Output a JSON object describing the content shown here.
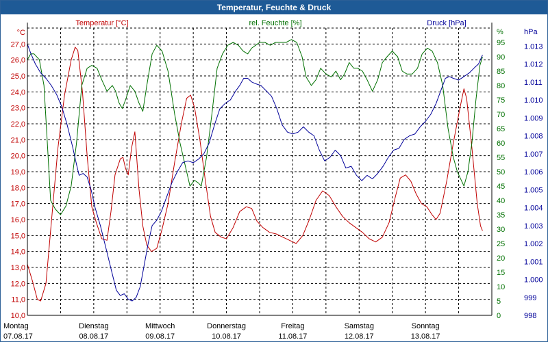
{
  "window": {
    "title": "Temperatur, Feuchte & Druck"
  },
  "colors": {
    "temperature": "#c00000",
    "humidity": "#007000",
    "pressure": "#000099",
    "grid": "#000000",
    "titlebar": "#1e5a96"
  },
  "chart_data": {
    "type": "line",
    "grid": true,
    "legend_placement": "top",
    "x_range": [
      0,
      7
    ],
    "x_ticks": [
      {
        "x": 0,
        "day": "Montag",
        "date": "07.08.17"
      },
      {
        "x": 1,
        "day": "Dienstag",
        "date": "08.08.17"
      },
      {
        "x": 2,
        "day": "Mittwoch",
        "date": "09.08.17"
      },
      {
        "x": 3,
        "day": "Donnerstag",
        "date": "10.08.17"
      },
      {
        "x": 4,
        "day": "Freitag",
        "date": "11.08.17"
      },
      {
        "x": 5,
        "day": "Samstag",
        "date": "12.08.17"
      },
      {
        "x": 6,
        "day": "Sonntag",
        "date": "13.08.17"
      }
    ],
    "axes": {
      "left": {
        "unit": "°C",
        "range": [
          10,
          28
        ],
        "ticks": [
          "10,0",
          "11,0",
          "12,0",
          "13,0",
          "14,0",
          "15,0",
          "16,0",
          "17,0",
          "18,0",
          "19,0",
          "20,0",
          "21,0",
          "22,0",
          "23,0",
          "24,0",
          "25,0",
          "26,0",
          "27,0"
        ]
      },
      "middle": {
        "unit": "%",
        "range": [
          0,
          100
        ],
        "ticks": [
          "0",
          "5",
          "10",
          "15",
          "20",
          "25",
          "30",
          "35",
          "40",
          "45",
          "50",
          "55",
          "60",
          "65",
          "70",
          "75",
          "80",
          "85",
          "90",
          "95"
        ]
      },
      "right": {
        "unit": "hPa",
        "range": [
          998,
          1014
        ],
        "ticks": [
          "998",
          "999",
          "1.000",
          "1.001",
          "1.002",
          "1.003",
          "1.004",
          "1.005",
          "1.006",
          "1.007",
          "1.008",
          "1.009",
          "1.010",
          "1.011",
          "1.012",
          "1.013"
        ]
      }
    },
    "series": [
      {
        "name": "Temperatur [°C]",
        "axis": "left",
        "color": "#c00000",
        "points": [
          [
            0,
            13.2
          ],
          [
            0.08,
            12.1
          ],
          [
            0.15,
            11.0
          ],
          [
            0.2,
            10.9
          ],
          [
            0.28,
            12.0
          ],
          [
            0.36,
            15.8
          ],
          [
            0.46,
            20.5
          ],
          [
            0.56,
            23.8
          ],
          [
            0.66,
            26.0
          ],
          [
            0.72,
            26.8
          ],
          [
            0.76,
            26.6
          ],
          [
            0.83,
            24.0
          ],
          [
            0.9,
            20.0
          ],
          [
            0.97,
            16.8
          ],
          [
            1.04,
            15.8
          ],
          [
            1.12,
            14.8
          ],
          [
            1.2,
            14.7
          ],
          [
            1.26,
            16.5
          ],
          [
            1.32,
            18.8
          ],
          [
            1.4,
            19.8
          ],
          [
            1.44,
            19.9
          ],
          [
            1.48,
            19.2
          ],
          [
            1.52,
            18.8
          ],
          [
            1.57,
            20.5
          ],
          [
            1.62,
            21.5
          ],
          [
            1.68,
            18.0
          ],
          [
            1.74,
            15.6
          ],
          [
            1.8,
            14.4
          ],
          [
            1.87,
            14.0
          ],
          [
            1.95,
            14.2
          ],
          [
            2.03,
            15.4
          ],
          [
            2.12,
            17.0
          ],
          [
            2.22,
            19.6
          ],
          [
            2.32,
            22.0
          ],
          [
            2.4,
            23.6
          ],
          [
            2.46,
            23.8
          ],
          [
            2.52,
            23.0
          ],
          [
            2.6,
            21.0
          ],
          [
            2.68,
            18.5
          ],
          [
            2.76,
            16.2
          ],
          [
            2.83,
            15.2
          ],
          [
            2.92,
            14.9
          ],
          [
            3.0,
            14.8
          ],
          [
            3.1,
            15.5
          ],
          [
            3.2,
            16.5
          ],
          [
            3.3,
            16.8
          ],
          [
            3.38,
            16.7
          ],
          [
            3.46,
            15.9
          ],
          [
            3.55,
            15.5
          ],
          [
            3.65,
            15.2
          ],
          [
            3.75,
            15.1
          ],
          [
            3.85,
            14.9
          ],
          [
            3.95,
            14.7
          ],
          [
            4.05,
            14.5
          ],
          [
            4.15,
            15.0
          ],
          [
            4.25,
            16.0
          ],
          [
            4.35,
            17.2
          ],
          [
            4.45,
            17.8
          ],
          [
            4.55,
            17.5
          ],
          [
            4.65,
            16.8
          ],
          [
            4.75,
            16.2
          ],
          [
            4.85,
            15.8
          ],
          [
            4.95,
            15.5
          ],
          [
            5.05,
            15.2
          ],
          [
            5.15,
            14.8
          ],
          [
            5.25,
            14.6
          ],
          [
            5.35,
            14.9
          ],
          [
            5.45,
            15.8
          ],
          [
            5.55,
            17.5
          ],
          [
            5.62,
            18.6
          ],
          [
            5.7,
            18.8
          ],
          [
            5.78,
            18.4
          ],
          [
            5.86,
            17.6
          ],
          [
            5.94,
            17.0
          ],
          [
            6.02,
            16.8
          ],
          [
            6.1,
            16.3
          ],
          [
            6.16,
            16.0
          ],
          [
            6.22,
            16.4
          ],
          [
            6.32,
            18.4
          ],
          [
            6.42,
            20.8
          ],
          [
            6.52,
            23.0
          ],
          [
            6.58,
            24.2
          ],
          [
            6.62,
            23.6
          ],
          [
            6.7,
            20.5
          ],
          [
            6.78,
            17.0
          ],
          [
            6.83,
            15.6
          ],
          [
            6.86,
            15.3
          ]
        ]
      },
      {
        "name": "rel. Feuchte [%]",
        "axis": "middle",
        "color": "#007000",
        "points": [
          [
            0,
            89
          ],
          [
            0.05,
            91
          ],
          [
            0.1,
            91
          ],
          [
            0.18,
            89
          ],
          [
            0.25,
            80
          ],
          [
            0.3,
            60
          ],
          [
            0.35,
            40
          ],
          [
            0.42,
            37
          ],
          [
            0.5,
            35
          ],
          [
            0.58,
            38
          ],
          [
            0.66,
            45
          ],
          [
            0.74,
            60
          ],
          [
            0.82,
            80
          ],
          [
            0.9,
            86
          ],
          [
            0.97,
            87
          ],
          [
            1.05,
            86
          ],
          [
            1.12,
            82
          ],
          [
            1.2,
            78
          ],
          [
            1.28,
            80
          ],
          [
            1.33,
            78
          ],
          [
            1.38,
            74
          ],
          [
            1.43,
            72
          ],
          [
            1.48,
            75
          ],
          [
            1.55,
            80
          ],
          [
            1.62,
            78
          ],
          [
            1.68,
            74
          ],
          [
            1.74,
            71
          ],
          [
            1.8,
            80
          ],
          [
            1.88,
            91
          ],
          [
            1.95,
            94
          ],
          [
            2.03,
            92
          ],
          [
            2.12,
            85
          ],
          [
            2.22,
            70
          ],
          [
            2.3,
            60
          ],
          [
            2.38,
            52
          ],
          [
            2.45,
            45
          ],
          [
            2.52,
            47
          ],
          [
            2.58,
            46
          ],
          [
            2.62,
            45
          ],
          [
            2.7,
            55
          ],
          [
            2.78,
            70
          ],
          [
            2.86,
            86
          ],
          [
            2.94,
            91
          ],
          [
            3.02,
            94
          ],
          [
            3.1,
            95
          ],
          [
            3.18,
            94
          ],
          [
            3.25,
            92
          ],
          [
            3.32,
            91
          ],
          [
            3.38,
            93
          ],
          [
            3.44,
            94
          ],
          [
            3.5,
            95
          ],
          [
            3.58,
            95
          ],
          [
            3.66,
            94
          ],
          [
            3.74,
            95
          ],
          [
            3.82,
            95
          ],
          [
            3.9,
            95
          ],
          [
            3.98,
            96
          ],
          [
            4.06,
            95
          ],
          [
            4.14,
            90
          ],
          [
            4.2,
            83
          ],
          [
            4.28,
            80
          ],
          [
            4.35,
            82
          ],
          [
            4.42,
            86
          ],
          [
            4.5,
            84
          ],
          [
            4.58,
            83
          ],
          [
            4.65,
            85
          ],
          [
            4.72,
            82
          ],
          [
            4.78,
            84
          ],
          [
            4.85,
            88
          ],
          [
            4.92,
            86
          ],
          [
            4.98,
            86
          ],
          [
            5.05,
            85
          ],
          [
            5.12,
            82
          ],
          [
            5.2,
            78
          ],
          [
            5.28,
            82
          ],
          [
            5.35,
            88
          ],
          [
            5.42,
            90
          ],
          [
            5.5,
            92
          ],
          [
            5.58,
            90
          ],
          [
            5.65,
            85
          ],
          [
            5.72,
            84
          ],
          [
            5.8,
            84
          ],
          [
            5.88,
            86
          ],
          [
            5.95,
            91
          ],
          [
            6.03,
            93
          ],
          [
            6.1,
            92
          ],
          [
            6.18,
            88
          ],
          [
            6.26,
            80
          ],
          [
            6.34,
            65
          ],
          [
            6.42,
            55
          ],
          [
            6.48,
            50
          ],
          [
            6.52,
            48
          ],
          [
            6.58,
            45
          ],
          [
            6.64,
            50
          ],
          [
            6.7,
            60
          ],
          [
            6.76,
            75
          ],
          [
            6.82,
            87
          ],
          [
            6.86,
            90
          ]
        ]
      },
      {
        "name": "Druck [hPa]",
        "axis": "right",
        "color": "#000099",
        "points": [
          [
            0,
            1013.1
          ],
          [
            0.05,
            1012.6
          ],
          [
            0.12,
            1012.0
          ],
          [
            0.2,
            1011.5
          ],
          [
            0.28,
            1011.2
          ],
          [
            0.36,
            1010.8
          ],
          [
            0.44,
            1010.3
          ],
          [
            0.52,
            1009.6
          ],
          [
            0.6,
            1008.6
          ],
          [
            0.68,
            1007.4
          ],
          [
            0.74,
            1006.4
          ],
          [
            0.78,
            1005.8
          ],
          [
            0.84,
            1005.9
          ],
          [
            0.9,
            1005.7
          ],
          [
            0.96,
            1005.0
          ],
          [
            1.02,
            1004.0
          ],
          [
            1.1,
            1003.0
          ],
          [
            1.18,
            1001.8
          ],
          [
            1.26,
            1000.6
          ],
          [
            1.34,
            999.4
          ],
          [
            1.4,
            999.1
          ],
          [
            1.46,
            999.2
          ],
          [
            1.52,
            998.9
          ],
          [
            1.58,
            998.8
          ],
          [
            1.64,
            999.0
          ],
          [
            1.7,
            999.6
          ],
          [
            1.76,
            1000.8
          ],
          [
            1.82,
            1002.0
          ],
          [
            1.88,
            1003.0
          ],
          [
            1.95,
            1003.3
          ],
          [
            2.02,
            1003.8
          ],
          [
            2.1,
            1004.6
          ],
          [
            2.18,
            1005.4
          ],
          [
            2.26,
            1006.0
          ],
          [
            2.34,
            1006.5
          ],
          [
            2.42,
            1006.6
          ],
          [
            2.5,
            1006.5
          ],
          [
            2.58,
            1006.7
          ],
          [
            2.66,
            1007.0
          ],
          [
            2.74,
            1007.6
          ],
          [
            2.82,
            1008.6
          ],
          [
            2.9,
            1009.5
          ],
          [
            2.98,
            1009.8
          ],
          [
            3.06,
            1010.0
          ],
          [
            3.14,
            1010.5
          ],
          [
            3.2,
            1010.8
          ],
          [
            3.26,
            1011.2
          ],
          [
            3.32,
            1011.2
          ],
          [
            3.38,
            1011.0
          ],
          [
            3.44,
            1010.9
          ],
          [
            3.52,
            1010.8
          ],
          [
            3.6,
            1010.5
          ],
          [
            3.68,
            1010.2
          ],
          [
            3.76,
            1009.5
          ],
          [
            3.84,
            1008.6
          ],
          [
            3.92,
            1008.2
          ],
          [
            4.0,
            1008.1
          ],
          [
            4.08,
            1008.2
          ],
          [
            4.16,
            1008.5
          ],
          [
            4.24,
            1008.2
          ],
          [
            4.32,
            1008.0
          ],
          [
            4.4,
            1007.2
          ],
          [
            4.48,
            1006.6
          ],
          [
            4.56,
            1006.8
          ],
          [
            4.64,
            1007.2
          ],
          [
            4.72,
            1006.9
          ],
          [
            4.8,
            1006.2
          ],
          [
            4.88,
            1006.3
          ],
          [
            4.96,
            1005.8
          ],
          [
            5.04,
            1005.5
          ],
          [
            5.12,
            1005.8
          ],
          [
            5.2,
            1005.6
          ],
          [
            5.28,
            1005.9
          ],
          [
            5.36,
            1006.3
          ],
          [
            5.44,
            1006.8
          ],
          [
            5.52,
            1007.2
          ],
          [
            5.6,
            1007.3
          ],
          [
            5.68,
            1007.8
          ],
          [
            5.76,
            1008.0
          ],
          [
            5.84,
            1008.1
          ],
          [
            5.92,
            1008.5
          ],
          [
            6.0,
            1008.8
          ],
          [
            6.08,
            1009.2
          ],
          [
            6.16,
            1009.8
          ],
          [
            6.24,
            1010.6
          ],
          [
            6.3,
            1011.2
          ],
          [
            6.36,
            1011.3
          ],
          [
            6.42,
            1011.2
          ],
          [
            6.5,
            1011.1
          ],
          [
            6.58,
            1011.3
          ],
          [
            6.66,
            1011.5
          ],
          [
            6.74,
            1011.8
          ],
          [
            6.8,
            1012.0
          ],
          [
            6.86,
            1012.5
          ]
        ]
      }
    ]
  }
}
